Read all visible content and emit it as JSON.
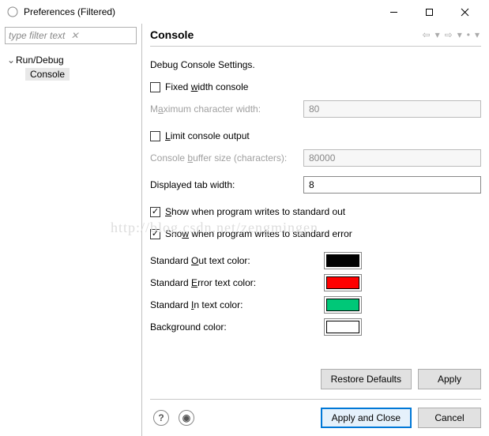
{
  "window": {
    "title": "Preferences (Filtered)"
  },
  "filter": {
    "placeholder": "type filter text"
  },
  "tree": {
    "parent": "Run/Debug",
    "child": "Console"
  },
  "page": {
    "title": "Console",
    "subtitle": "Debug Console Settings.",
    "fixed_width_label": "Fixed width console",
    "max_char_width_label": "Maximum character width:",
    "max_char_width_value": "80",
    "limit_output_label": "Limit console output",
    "buffer_size_label": "Console buffer size (characters):",
    "buffer_size_value": "80000",
    "tab_width_label": "Displayed tab width:",
    "tab_width_value": "8",
    "show_stdout_label": "Show when program writes to standard out",
    "show_stderr_label": "Show when program writes to standard error",
    "stdout_color_label": "Standard Out text color:",
    "stderr_color_label": "Standard Error text color:",
    "stdin_color_label": "Standard In text color:",
    "bg_color_label": "Background color:",
    "colors": {
      "stdout": "#000000",
      "stderr": "#ff0000",
      "stdin": "#00c878",
      "bg": "#ffffff"
    }
  },
  "buttons": {
    "restore": "Restore Defaults",
    "apply": "Apply",
    "apply_close": "Apply and Close",
    "cancel": "Cancel"
  },
  "watermark": "http://blog.csdn.net/zengmingen"
}
